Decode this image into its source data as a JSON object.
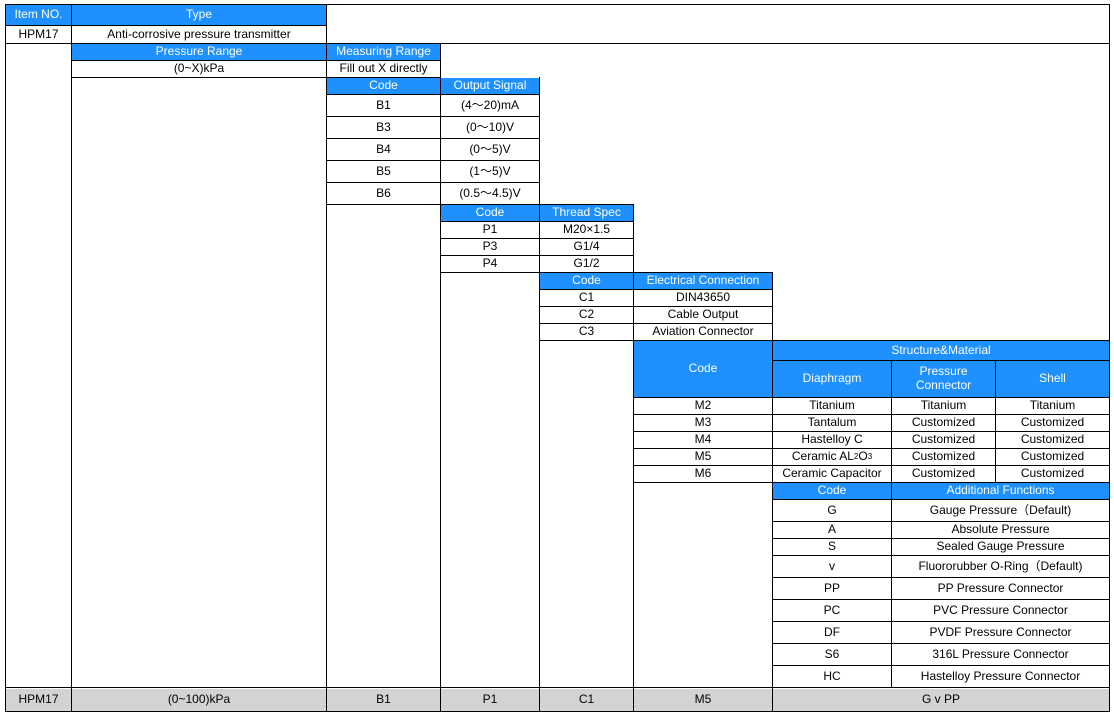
{
  "item": {
    "header": "Item NO.",
    "value": "HPM17"
  },
  "type": {
    "header": "Type",
    "value": "Anti-corrosive pressure transmitter"
  },
  "pressure_range": {
    "header": "Pressure Range",
    "value": "(0~X)kPa"
  },
  "measuring_range": {
    "header": "Measuring Range",
    "value": "Fill out X directly"
  },
  "output_signal": {
    "code_header": "Code",
    "header": "Output Signal",
    "rows": [
      {
        "code": "B1",
        "value": "(4～20)mA"
      },
      {
        "code": "B3",
        "value": "(0～10)V"
      },
      {
        "code": "B4",
        "value": "(0～5)V"
      },
      {
        "code": "B5",
        "value": "(1～5)V"
      },
      {
        "code": "B6",
        "value": "(0.5～4.5)V"
      }
    ]
  },
  "thread_spec": {
    "code_header": "Code",
    "header": "Thread Spec",
    "rows": [
      {
        "code": "P1",
        "value": "M20×1.5"
      },
      {
        "code": "P3",
        "value": "G1/4"
      },
      {
        "code": "P4",
        "value": "G1/2"
      }
    ]
  },
  "electrical": {
    "code_header": "Code",
    "header": "Electrical Connection",
    "rows": [
      {
        "code": "C1",
        "value": "DIN43650"
      },
      {
        "code": "C2",
        "value": "Cable Output"
      },
      {
        "code": "C3",
        "value": "Aviation Connector"
      }
    ]
  },
  "structure": {
    "code_header": "Code",
    "header": "Structure&Material",
    "sub_headers": {
      "diaphragm": "Diaphragm",
      "connector": "Pressure Connector",
      "shell": "Shell"
    },
    "rows": [
      {
        "code": "M2",
        "diaphragm": "Titanium",
        "connector": "Titanium",
        "shell": "Titanium"
      },
      {
        "code": "M3",
        "diaphragm": "Tantalum",
        "connector": "Customized",
        "shell": "Customized"
      },
      {
        "code": "M4",
        "diaphragm": "Hastelloy C",
        "connector": "Customized",
        "shell": "Customized"
      },
      {
        "code": "M5",
        "diaphragm": "Ceramic AL",
        "diaphragm_sub1": "2",
        "diaphragm_mid": "O",
        "diaphragm_sub2": "3",
        "connector": "Customized",
        "shell": "Customized"
      },
      {
        "code": "M6",
        "diaphragm": "Ceramic Capacitor",
        "connector": "Customized",
        "shell": "Customized"
      }
    ]
  },
  "additional": {
    "code_header": "Code",
    "header": "Additional Functions",
    "rows": [
      {
        "code": "G",
        "value": "Gauge Pressure（Default)"
      },
      {
        "code": "A",
        "value": "Absolute Pressure"
      },
      {
        "code": "S",
        "value": "Sealed Gauge Pressure"
      },
      {
        "code": "v",
        "value": "Fluororubber O-Ring（Default)"
      },
      {
        "code": "PP",
        "value": "PP Pressure Connector"
      },
      {
        "code": "PC",
        "value": "PVC Pressure Connector"
      },
      {
        "code": "DF",
        "value": "PVDF Pressure Connector"
      },
      {
        "code": "S6",
        "value": "316L Pressure Connector"
      },
      {
        "code": "HC",
        "value": "Hastelloy Pressure Connector"
      }
    ]
  },
  "example": {
    "item": "HPM17",
    "range": "(0~100)kPa",
    "output": "B1",
    "thread": "P1",
    "electrical": "C1",
    "structure": "M5",
    "additional": "G v PP"
  }
}
